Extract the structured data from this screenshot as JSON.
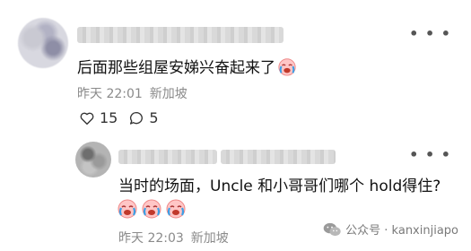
{
  "comments": [
    {
      "text": "后面那些组屋安娣兴奋起来了",
      "time": "昨天 22:01",
      "location": "新加坡",
      "likes": "15",
      "replies": "5",
      "emoji_icon": "crying-laughing-face-icon"
    },
    {
      "text": "当时的场面，Uncle 和小哥哥们哪个 hold得住?",
      "time": "昨天 22:03",
      "location": "新加坡",
      "emoji_icons": [
        "crying-laughing-face-icon",
        "crying-laughing-face-icon",
        "crying-laughing-face-icon"
      ]
    }
  ],
  "watermark": {
    "text": "公众号 · kanxinjiapo",
    "icon": "wechat-icon"
  },
  "colors": {
    "meta": "#8a8a8a",
    "text": "#111111",
    "background": "#ffffff"
  }
}
